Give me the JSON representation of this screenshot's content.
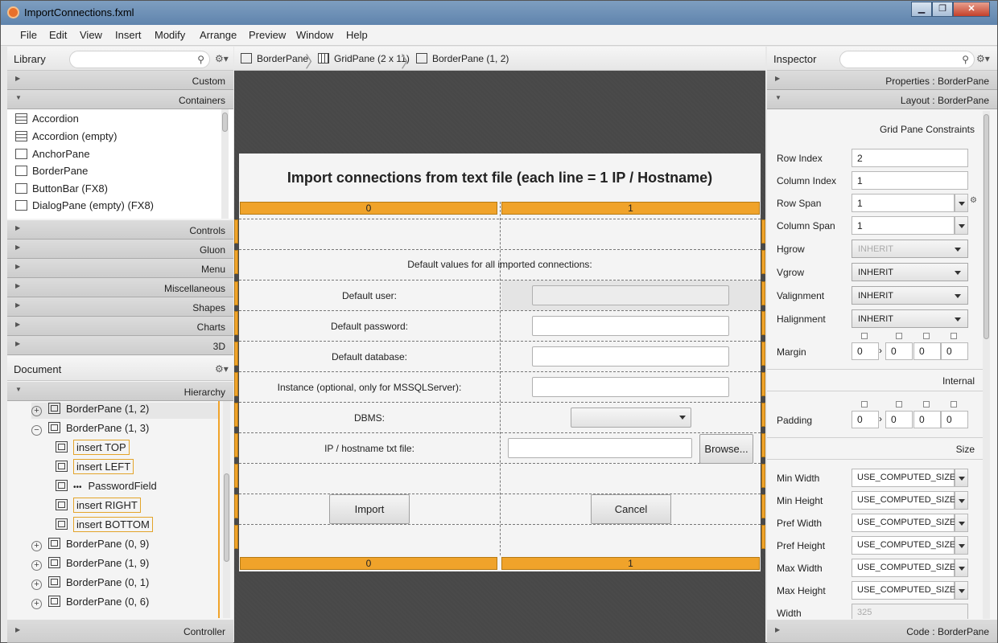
{
  "window": {
    "title": "ImportConnections.fxml"
  },
  "menu": [
    "File",
    "Edit",
    "View",
    "Insert",
    "Modify",
    "Arrange",
    "Preview",
    "Window",
    "Help"
  ],
  "library": {
    "title": "Library",
    "sections_top": [
      "Custom",
      "Containers"
    ],
    "items": [
      "Accordion",
      "Accordion  (empty)",
      "AnchorPane",
      "BorderPane",
      "ButtonBar  (FX8)",
      "DialogPane (empty)  (FX8)"
    ],
    "sections": [
      "Controls",
      "Gluon",
      "Menu",
      "Miscellaneous",
      "Shapes",
      "Charts",
      "3D"
    ]
  },
  "document": {
    "title": "Document",
    "hierarchy_label": "Hierarchy",
    "items": [
      "BorderPane (1, 2)",
      "BorderPane (1, 3)",
      "insert TOP",
      "insert LEFT",
      "PasswordField",
      "insert RIGHT",
      "insert BOTTOM",
      "BorderPane (0, 9)",
      "BorderPane (1, 9)",
      "BorderPane (0, 1)",
      "BorderPane (0, 6)"
    ],
    "controller": "Controller"
  },
  "breadcrumb": [
    "BorderPane",
    "GridPane (2 x 11)",
    "BorderPane (1, 2)"
  ],
  "form": {
    "title": "Import connections from text file (each line = 1 IP / Hostname)",
    "col0": "0",
    "col1": "1",
    "defaults_label": "Default values for all imported connections:",
    "user_label": "Default user:",
    "password_label": "Default password:",
    "database_label": "Default database:",
    "instance_label": "Instance (optional, only for MSSQLServer):",
    "dbms_label": "DBMS:",
    "file_label": "IP / hostname txt file:",
    "browse": "Browse...",
    "import": "Import",
    "cancel": "Cancel"
  },
  "inspector": {
    "title": "Inspector",
    "properties": "Properties : BorderPane",
    "layout": "Layout : BorderPane",
    "gpc": "Grid Pane Constraints",
    "row_index_label": "Row Index",
    "row_index": "2",
    "column_index_label": "Column Index",
    "column_index": "1",
    "row_span_label": "Row Span",
    "row_span": "1",
    "column_span_label": "Column Span",
    "column_span": "1",
    "hgrow_label": "Hgrow",
    "hgrow": "INHERIT",
    "vgrow_label": "Vgrow",
    "vgrow": "INHERIT",
    "valignment_label": "Valignment",
    "valignment": "INHERIT",
    "halignment_label": "Halignment",
    "halignment": "INHERIT",
    "margin_label": "Margin",
    "margin": [
      "0",
      "0",
      "0",
      "0"
    ],
    "internal": "Internal",
    "padding_label": "Padding",
    "padding": [
      "0",
      "0",
      "0",
      "0"
    ],
    "size": "Size",
    "min_width_label": "Min Width",
    "min_height_label": "Min Height",
    "pref_width_label": "Pref Width",
    "pref_height_label": "Pref Height",
    "max_width_label": "Max Width",
    "max_height_label": "Max Height",
    "computed": "USE_COMPUTED_SIZE",
    "width_label": "Width",
    "width": "325",
    "code": "Code : BorderPane"
  }
}
